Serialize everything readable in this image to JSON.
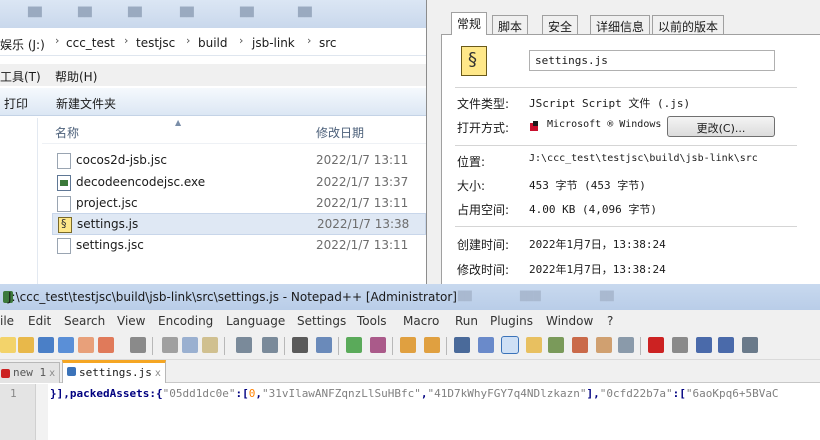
{
  "explorer": {
    "address_crumbs": [
      "娱乐 (J:)",
      "ccc_test",
      "testjsc",
      "build",
      "jsb-link",
      "src"
    ],
    "menubar": [
      "工具(T)",
      "帮助(H)"
    ],
    "toolbar": [
      "打印",
      "新建文件夹"
    ],
    "columns": {
      "name": "名称",
      "modified": "修改日期"
    },
    "files": [
      {
        "name": "cocos2d-jsb.jsc",
        "date": "2022/1/7 13:11",
        "icon": "blank-file-icon",
        "selected": false
      },
      {
        "name": "decodeencodejsc.exe",
        "date": "2022/1/7 13:37",
        "icon": "exe-file-icon",
        "selected": false
      },
      {
        "name": "project.jsc",
        "date": "2022/1/7 13:11",
        "icon": "blank-file-icon",
        "selected": false
      },
      {
        "name": "settings.js",
        "date": "2022/1/7 13:38",
        "icon": "script-file-icon",
        "selected": true
      },
      {
        "name": "settings.jsc",
        "date": "2022/1/7 13:11",
        "icon": "blank-file-icon",
        "selected": false
      }
    ]
  },
  "properties": {
    "tabs": [
      "常规",
      "脚本",
      "安全",
      "详细信息",
      "以前的版本"
    ],
    "active_tab": "常规",
    "filename": "settings.js",
    "labels": {
      "type": "文件类型:",
      "opens_with": "打开方式:",
      "location": "位置:",
      "size": "大小:",
      "size_on_disk": "占用空间:",
      "created": "创建时间:",
      "modified": "修改时间:"
    },
    "values": {
      "type": "JScript Script 文件 (.js)",
      "opens_with": "Microsoft ® Windows",
      "location": "J:\\ccc_test\\testjsc\\build\\jsb-link\\src",
      "size": "453 字节 (453 字节)",
      "size_on_disk": "4.00 KB (4,096 字节)",
      "created": "2022年1月7日，13:38:24",
      "modified": "2022年1月7日，13:38:24"
    },
    "change_button": "更改(C)..."
  },
  "notepad": {
    "title": "J:\\ccc_test\\testjsc\\build\\jsb-link\\src\\settings.js - Notepad++ [Administrator]",
    "menu": [
      "ile",
      "Edit",
      "Search",
      "View",
      "Encoding",
      "Language",
      "Settings",
      "Tools",
      "Macro",
      "Run",
      "Plugins",
      "Window",
      "?"
    ],
    "tabs": [
      {
        "label": "new 1",
        "active": false
      },
      {
        "label": "settings.js",
        "active": true
      }
    ],
    "line_number": "1",
    "code": {
      "prefix": "}],packedAssets:{",
      "k1": "\"05dd1dc0e\"",
      "t1": ":[",
      "n1": "0",
      "t2": ",",
      "s1": "\"31vIlawANFZqnzLlSuHBfc\"",
      "t3": ",",
      "s2": "\"41D7kWhyFGY7q4NDlzkazn\"",
      "t4": "],",
      "k2": "\"0cfd22b7a\"",
      "t5": ":[",
      "s3": "\"6aoKpq6+5BVaC"
    }
  },
  "colors": {
    "npp_tab_accent": "#f5a623",
    "selection_blue": "#dfe8f4",
    "npp_number": "#ff8000",
    "npp_string": "#808080"
  }
}
